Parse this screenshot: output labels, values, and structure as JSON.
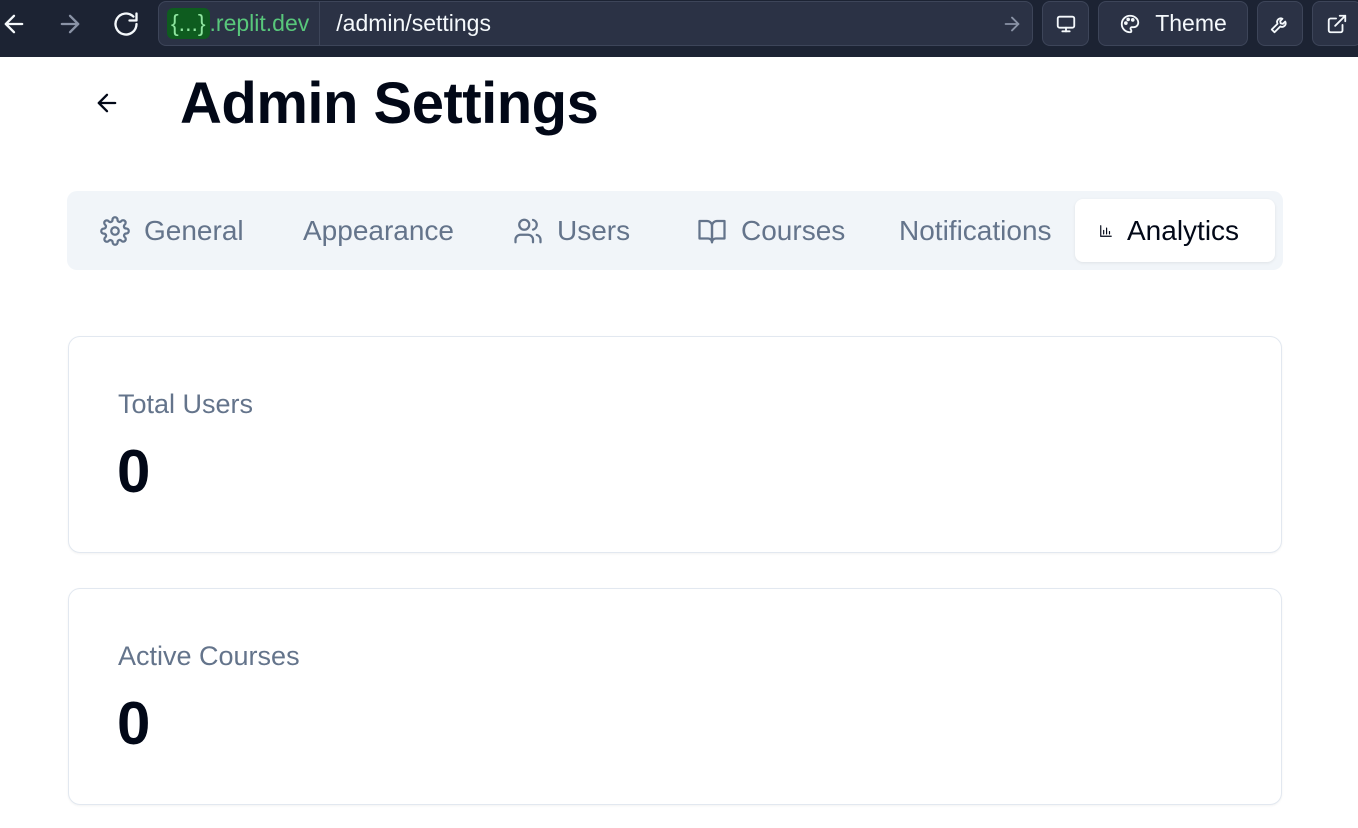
{
  "browser": {
    "domain_badge": "{...}",
    "domain_suffix": ".replit.dev",
    "path": "/admin/settings",
    "theme_label": "Theme"
  },
  "page": {
    "title": "Admin Settings"
  },
  "tabs": [
    {
      "label": "General",
      "icon": "gear-icon",
      "active": false
    },
    {
      "label": "Appearance",
      "icon": "",
      "active": false
    },
    {
      "label": "Users",
      "icon": "users-icon",
      "active": false
    },
    {
      "label": "Courses",
      "icon": "book-open-icon",
      "active": false
    },
    {
      "label": "Notifications",
      "icon": "",
      "active": false
    },
    {
      "label": "Analytics",
      "icon": "bar-chart-icon",
      "active": true
    }
  ],
  "stats": [
    {
      "label": "Total Users",
      "value": "0"
    },
    {
      "label": "Active Courses",
      "value": "0"
    }
  ],
  "colors": {
    "chrome_bg": "#1c2333",
    "domain_green": "#58c77b",
    "tab_bg": "#f1f5f9",
    "muted_text": "#64748b",
    "title_text": "#020817"
  }
}
